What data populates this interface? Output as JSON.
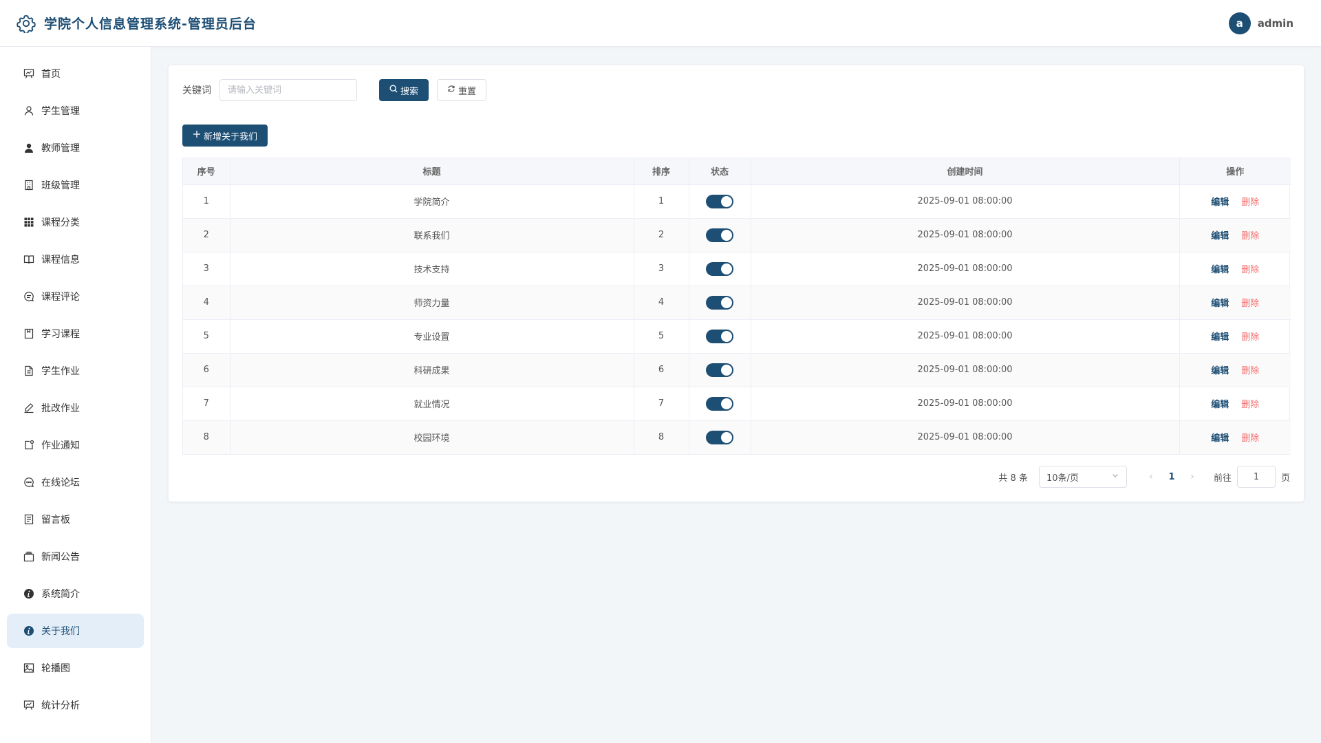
{
  "app": {
    "title": "学院个人信息管理系统-管理员后台"
  },
  "user": {
    "avatar_letter": "a",
    "name": "admin"
  },
  "sidebar": {
    "items": [
      {
        "label": "首页",
        "icon": "dashboard-icon",
        "active": false
      },
      {
        "label": "学生管理",
        "icon": "user-outline-icon",
        "active": false
      },
      {
        "label": "教师管理",
        "icon": "user-filled-icon",
        "active": false
      },
      {
        "label": "班级管理",
        "icon": "building-icon",
        "active": false
      },
      {
        "label": "课程分类",
        "icon": "grid-icon",
        "active": false
      },
      {
        "label": "课程信息",
        "icon": "book-icon",
        "active": false
      },
      {
        "label": "课程评论",
        "icon": "chat-icon",
        "active": false
      },
      {
        "label": "学习课程",
        "icon": "notebook-icon",
        "active": false
      },
      {
        "label": "学生作业",
        "icon": "document-icon",
        "active": false
      },
      {
        "label": "批改作业",
        "icon": "edit-pen-icon",
        "active": false
      },
      {
        "label": "作业通知",
        "icon": "notification-icon",
        "active": false
      },
      {
        "label": "在线论坛",
        "icon": "chat-dots-icon",
        "active": false
      },
      {
        "label": "留言板",
        "icon": "memo-icon",
        "active": false
      },
      {
        "label": "新闻公告",
        "icon": "news-icon",
        "active": false
      },
      {
        "label": "系统简介",
        "icon": "info-filled-icon",
        "active": false
      },
      {
        "label": "关于我们",
        "icon": "info-filled-icon",
        "active": true
      },
      {
        "label": "轮播图",
        "icon": "picture-icon",
        "active": false
      },
      {
        "label": "统计分析",
        "icon": "chart-board-icon",
        "active": false
      }
    ]
  },
  "search": {
    "label": "关键词",
    "placeholder": "请输入关键词",
    "value": "",
    "search_button": "搜索",
    "reset_button": "重置"
  },
  "add_button": "新增关于我们",
  "table": {
    "columns": [
      "序号",
      "标题",
      "排序",
      "状态",
      "创建时间",
      "操作"
    ],
    "edit_label": "编辑",
    "delete_label": "删除",
    "rows": [
      {
        "index": "1",
        "title": "学院简介",
        "sort": "1",
        "status": true,
        "created": "2025-09-01 08:00:00"
      },
      {
        "index": "2",
        "title": "联系我们",
        "sort": "2",
        "status": true,
        "created": "2025-09-01 08:00:00"
      },
      {
        "index": "3",
        "title": "技术支持",
        "sort": "3",
        "status": true,
        "created": "2025-09-01 08:00:00"
      },
      {
        "index": "4",
        "title": "师资力量",
        "sort": "4",
        "status": true,
        "created": "2025-09-01 08:00:00"
      },
      {
        "index": "5",
        "title": "专业设置",
        "sort": "5",
        "status": true,
        "created": "2025-09-01 08:00:00"
      },
      {
        "index": "6",
        "title": "科研成果",
        "sort": "6",
        "status": true,
        "created": "2025-09-01 08:00:00"
      },
      {
        "index": "7",
        "title": "就业情况",
        "sort": "7",
        "status": true,
        "created": "2025-09-01 08:00:00"
      },
      {
        "index": "8",
        "title": "校园环境",
        "sort": "8",
        "status": true,
        "created": "2025-09-01 08:00:00"
      }
    ]
  },
  "pagination": {
    "total_text": "共 8 条",
    "page_size": "10条/页",
    "current_page": "1",
    "goto_label": "前往",
    "goto_value": "1",
    "page_suffix": "页"
  },
  "colors": {
    "primary": "#1d4e74",
    "danger": "#f56c6c",
    "active_bg": "#e3eef8",
    "page_bg": "#f3f6f9"
  }
}
